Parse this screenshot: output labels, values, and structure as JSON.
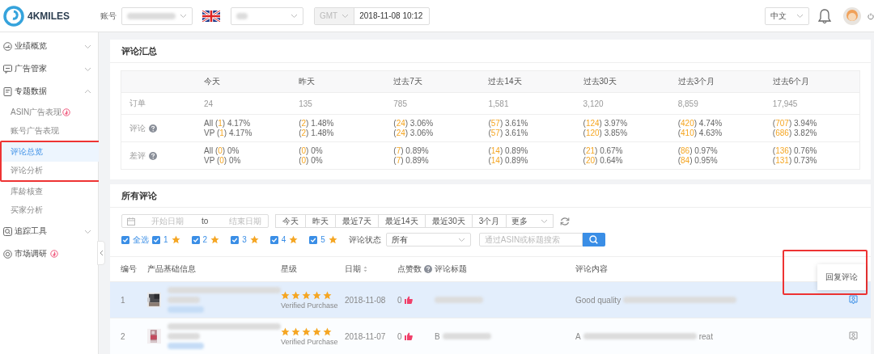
{
  "header": {
    "logo": "4KMILES",
    "account_label": "账号",
    "timezone": {
      "value": "GMT",
      "disabled": true
    },
    "datetime": "2018-11-08 10:12",
    "language": "中文"
  },
  "sidebar": {
    "items": [
      {
        "label": "业绩概览",
        "expanded": false
      },
      {
        "label": "广告管家",
        "expanded": false
      },
      {
        "label": "专题数据",
        "expanded": true,
        "children": [
          {
            "label": "ASIN广告表现",
            "hot": true,
            "selected": false,
            "annotated": false
          },
          {
            "label": "账号广告表现",
            "hot": false,
            "selected": false,
            "annotated": false
          },
          {
            "label": "评论总览",
            "hot": false,
            "selected": true,
            "annotated": true
          },
          {
            "label": "评论分析",
            "hot": false,
            "selected": false,
            "annotated": true
          },
          {
            "label": "库龄核查",
            "hot": false,
            "selected": false,
            "annotated": false
          },
          {
            "label": "买家分析",
            "hot": false,
            "selected": false,
            "annotated": false
          }
        ]
      },
      {
        "label": "追踪工具",
        "expanded": false
      },
      {
        "label": "市场调研",
        "hot": true
      }
    ]
  },
  "summary": {
    "title": "评论汇总",
    "columns": [
      "今天",
      "昨天",
      "过去7天",
      "过去14天",
      "过去30天",
      "过去3个月",
      "过去6个月"
    ],
    "rows": [
      {
        "label": "订单",
        "help": false,
        "cells": [
          [
            {
              "text": "24"
            }
          ],
          [
            {
              "text": "135"
            }
          ],
          [
            {
              "text": "785"
            }
          ],
          [
            {
              "text": "1,581"
            }
          ],
          [
            {
              "text": "3,120"
            }
          ],
          [
            {
              "text": "8,859"
            }
          ],
          [
            {
              "text": "17,945"
            }
          ]
        ]
      },
      {
        "label": "评论",
        "help": true,
        "cells": [
          [
            {
              "lead": "All (",
              "count": "1",
              "tail": ") 4.17%"
            },
            {
              "lead": "VP (",
              "count": "1",
              "tail": ") 4.17%"
            }
          ],
          [
            {
              "lead": "(",
              "count": "2",
              "tail": ") 1.48%"
            },
            {
              "lead": "(",
              "count": "2",
              "tail": ") 1.48%"
            }
          ],
          [
            {
              "lead": "(",
              "count": "24",
              "tail": ") 3.06%"
            },
            {
              "lead": "(",
              "count": "24",
              "tail": ") 3.06%"
            }
          ],
          [
            {
              "lead": "(",
              "count": "57",
              "tail": ") 3.61%"
            },
            {
              "lead": "(",
              "count": "57",
              "tail": ") 3.61%"
            }
          ],
          [
            {
              "lead": "(",
              "count": "124",
              "tail": ") 3.97%"
            },
            {
              "lead": "(",
              "count": "120",
              "tail": ") 3.85%"
            }
          ],
          [
            {
              "lead": "(",
              "count": "420",
              "tail": ") 4.74%"
            },
            {
              "lead": "(",
              "count": "410",
              "tail": ") 4.63%"
            }
          ],
          [
            {
              "lead": "(",
              "count": "707",
              "tail": ") 3.94%"
            },
            {
              "lead": "(",
              "count": "686",
              "tail": ") 3.82%"
            }
          ]
        ]
      },
      {
        "label": "差评",
        "help": true,
        "cells": [
          [
            {
              "lead": "All (",
              "count": "0",
              "tail": ") 0%"
            },
            {
              "lead": "VP (",
              "count": "0",
              "tail": ") 0%"
            }
          ],
          [
            {
              "lead": "(",
              "count": "0",
              "tail": ") 0%"
            },
            {
              "lead": "(",
              "count": "0",
              "tail": ") 0%"
            }
          ],
          [
            {
              "lead": "(",
              "count": "7",
              "tail": ") 0.89%"
            },
            {
              "lead": "(",
              "count": "7",
              "tail": ") 0.89%"
            }
          ],
          [
            {
              "lead": "(",
              "count": "14",
              "tail": ") 0.89%"
            },
            {
              "lead": "(",
              "count": "14",
              "tail": ") 0.89%"
            }
          ],
          [
            {
              "lead": "(",
              "count": "21",
              "tail": ") 0.67%"
            },
            {
              "lead": "(",
              "count": "20",
              "tail": ") 0.64%"
            }
          ],
          [
            {
              "lead": "(",
              "count": "86",
              "tail": ") 0.97%"
            },
            {
              "lead": "(",
              "count": "84",
              "tail": ") 0.95%"
            }
          ],
          [
            {
              "lead": "(",
              "count": "136",
              "tail": ") 0.76%"
            },
            {
              "lead": "(",
              "count": "131",
              "tail": ") 0.73%"
            }
          ]
        ]
      }
    ]
  },
  "reviews": {
    "title": "所有评论",
    "date_range": {
      "start_placeholder": "开始日期",
      "separator": "to",
      "end_placeholder": "结束日期"
    },
    "quick_ranges": [
      {
        "label": "今天",
        "selected": false
      },
      {
        "label": "昨天",
        "selected": false
      },
      {
        "label": "最近7天",
        "selected": false
      },
      {
        "label": "最近14天",
        "selected": false
      },
      {
        "label": "最近30天",
        "selected": false
      },
      {
        "label": "3个月",
        "selected": false
      }
    ],
    "more": "更多",
    "star_filters": [
      {
        "label": "全选",
        "checked": true,
        "star": false
      },
      {
        "label": "1",
        "checked": true,
        "star": true
      },
      {
        "label": "2",
        "checked": true,
        "star": true
      },
      {
        "label": "3",
        "checked": true,
        "star": true
      },
      {
        "label": "4",
        "checked": true,
        "star": true
      },
      {
        "label": "5",
        "checked": true,
        "star": true
      }
    ],
    "status_label": "评论状态",
    "status_value": "所有",
    "search_placeholder": "通过ASIN或标题搜索",
    "columns": [
      {
        "label": "编号"
      },
      {
        "label": "产品基础信息"
      },
      {
        "label": "星级"
      },
      {
        "label": "日期",
        "sortable": true
      },
      {
        "label": "点赞数",
        "help": true
      },
      {
        "label": "评论标题"
      },
      {
        "label": "评论内容"
      }
    ],
    "rows": [
      {
        "index": "1",
        "stars": 5,
        "verified": "Verified Purchase",
        "date": "2018-11-08",
        "likes": "0",
        "content_lead": "Good quality",
        "selected": true,
        "reply_active": true
      },
      {
        "index": "2",
        "stars": 5,
        "verified": "Verified Purchase",
        "date": "2018-11-07",
        "likes": "0",
        "title_lead": "B",
        "content_lead": "A",
        "content_tail": "reat",
        "selected": false,
        "reply_active": false
      }
    ],
    "popup": {
      "label": "回复评论",
      "annotated": true
    }
  }
}
